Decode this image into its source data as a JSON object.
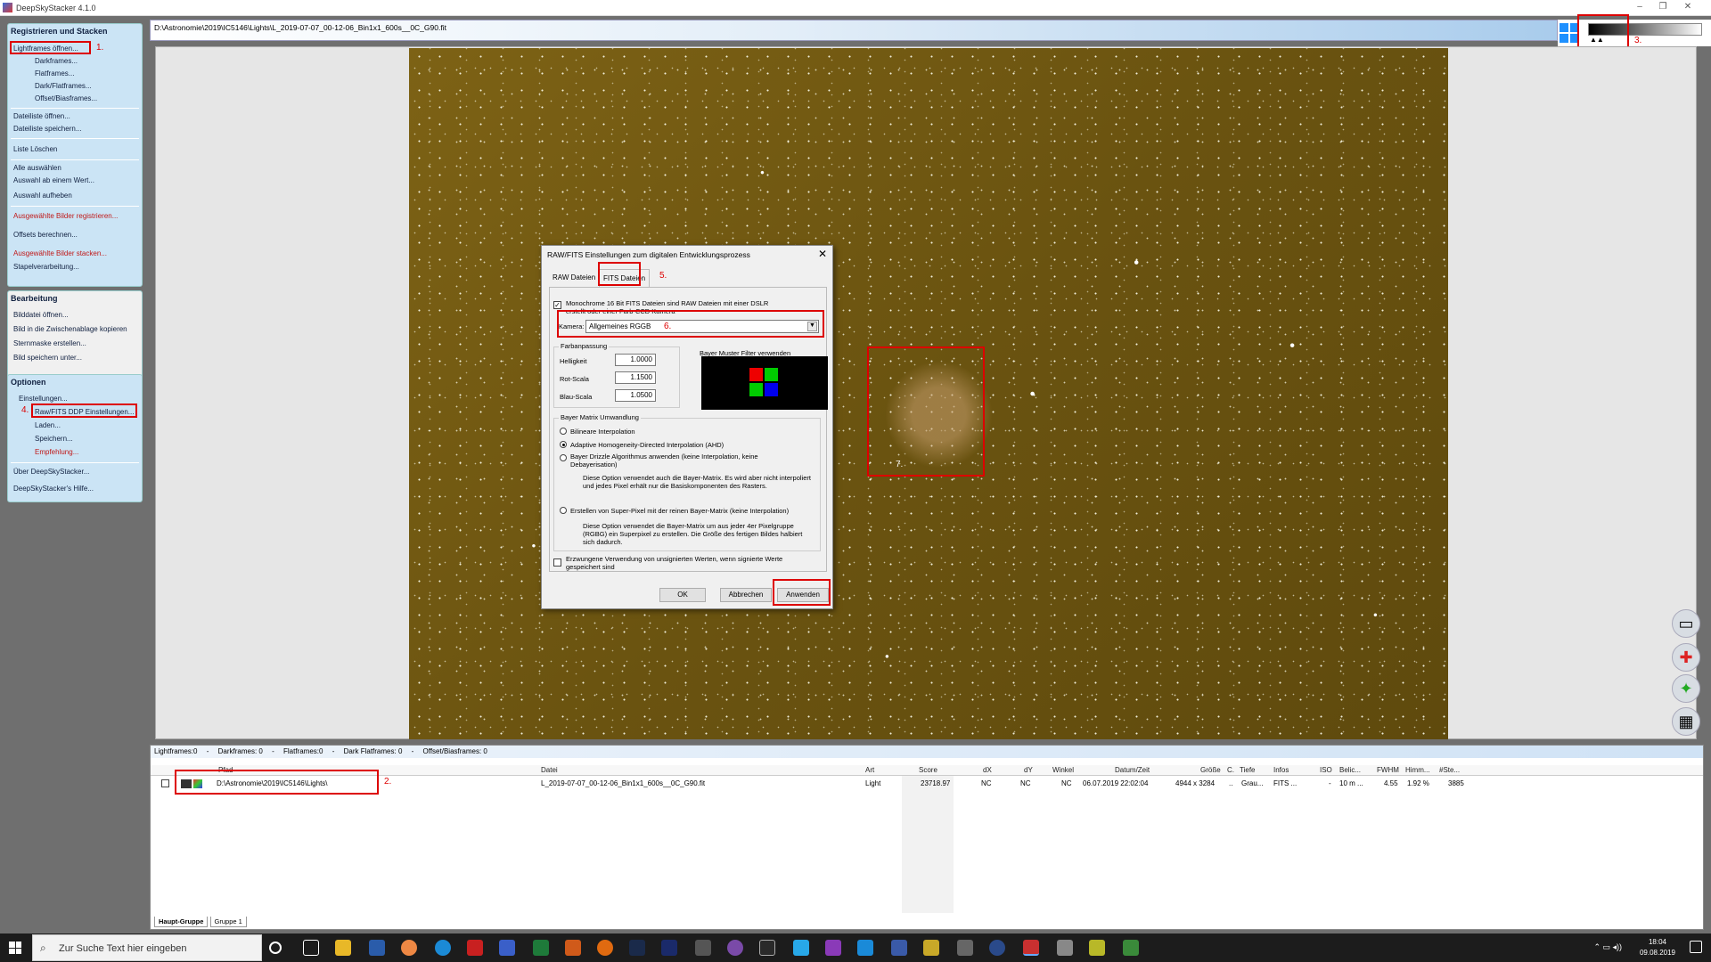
{
  "window": {
    "title": "DeepSkyStacker 4.1.0",
    "minimize": "–",
    "restore": "❐",
    "close": "✕"
  },
  "sidebar": {
    "register_header": "Registrieren und Stacken",
    "register_items": [
      "Lightframes öffnen...",
      "Darkframes...",
      "Flatframes...",
      "Dark/Flatframes...",
      "Offset/Biasframes...",
      "Dateiliste öffnen...",
      "Dateiliste speichern...",
      "Liste Löschen",
      "Alle auswählen",
      "Auswahl ab einem Wert...",
      "Auswahl aufheben",
      "Ausgewählte Bilder registrieren...",
      "Offsets berechnen...",
      "Ausgewählte Bilder stacken...",
      "Stapelverarbeitung..."
    ],
    "edit_header": "Bearbeitung",
    "edit_items": [
      "Bilddatei öffnen...",
      "Bild in die Zwischenablage kopieren",
      "Sternmaske erstellen...",
      "Bild speichern unter..."
    ],
    "options_header": "Optionen",
    "options_items": [
      "Einstellungen...",
      "Raw/FITS DDP Einstellungen...",
      "Laden...",
      "Speichern...",
      "Empfehlung...",
      "Über DeepSkyStacker...",
      "DeepSkyStacker's Hilfe..."
    ]
  },
  "annotations": [
    "1.",
    "2.",
    "3.",
    "4.",
    "5.",
    "6.",
    "7."
  ],
  "path": "D:\\Astronomie\\2019\\IC5146\\Lights\\L_2019-07-07_00-12-06_Bin1x1_600s__0C_G90.fit",
  "dialog": {
    "title": "RAW/FITS Einstellungen zum digitalen Entwicklungsprozess",
    "close": "✕",
    "tabs": [
      "RAW Dateien",
      "FITS Dateien"
    ],
    "mono_checkbox": "Monochrome 16 Bit FITS Dateien sind RAW Dateien mit einer DSLR erstellt oder einer Farb-CCD Kamera",
    "camera_label": "Kamera:",
    "camera_value": "Allgemeines RGGB",
    "color_group": "Farbanpassung",
    "brightness_label": "Helligkeit",
    "brightness_value": "1.0000",
    "red_label": "Rot-Scala",
    "red_value": "1.1500",
    "blue_label": "Blau-Scala",
    "blue_value": "1.0500",
    "bayer_label": "Bayer Muster Filter verwenden",
    "bayer_group": "Bayer Matrix Umwandlung",
    "opt_bilinear": "Bilineare Interpolation",
    "opt_ahd": "Adaptive Homogeneity-Directed Interpolation (AHD)",
    "opt_drizzle": "Bayer Drizzle Algorithmus anwenden (keine Interpolation, keine Debayerisation)",
    "drizzle_note": "Diese Option verwendet auch die Bayer-Matrix. Es wird aber nicht interpoliert und jedes Pixel erhält nur die Basiskomponenten des Rasters.",
    "opt_superpixel": "Erstellen von Super-Pixel mit der reinen Bayer-Matrix (keine Interpolation)",
    "superpixel_note": "Diese Option verwendet die Bayer-Matrix um aus jeder 4er Pixelgruppe (RGBG) ein Superpixel zu erstellen. Die Größe des fertigen Bildes halbiert sich dadurch.",
    "force_unsigned": "Erzwungene Verwendung von unsignierten Werten, wenn signierte Werte gespeichert sind",
    "ok": "OK",
    "cancel": "Abbrechen",
    "apply": "Anwenden"
  },
  "counts": [
    "Lightframes:0",
    "-",
    "Darkframes: 0",
    "-",
    "Flatframes:0",
    "-",
    "Dark Flatframes: 0",
    "-",
    "Offset/Biasframes: 0"
  ],
  "table": {
    "columns": [
      "Pfad",
      "Datei",
      "Art",
      "Score",
      "dX",
      "dY",
      "Winkel",
      "Datum/Zeit",
      "Größe",
      "C.",
      "Tiefe",
      "Infos",
      "ISO",
      "Belic...",
      "FWHM",
      "Himm...",
      "#Ste..."
    ],
    "row": [
      "D:\\Astronomie\\2019\\IC5146\\Lights\\",
      "L_2019-07-07_00-12-06_Bin1x1_600s__0C_G90.fit",
      "Light",
      "23718.97",
      "NC",
      "NC",
      "NC",
      "06.07.2019 22:02:04",
      "4944 x 3284",
      "..",
      "Grau...",
      "FITS ...",
      "-",
      "10 m ...",
      "4.55",
      "1.92 %",
      "3885"
    ]
  },
  "groups": [
    "Haupt-Gruppe",
    "Gruppe 1"
  ],
  "taskbar": {
    "search_placeholder": "Zur Suche Text hier eingeben",
    "time": "18:04",
    "date": "09.08.2019"
  }
}
